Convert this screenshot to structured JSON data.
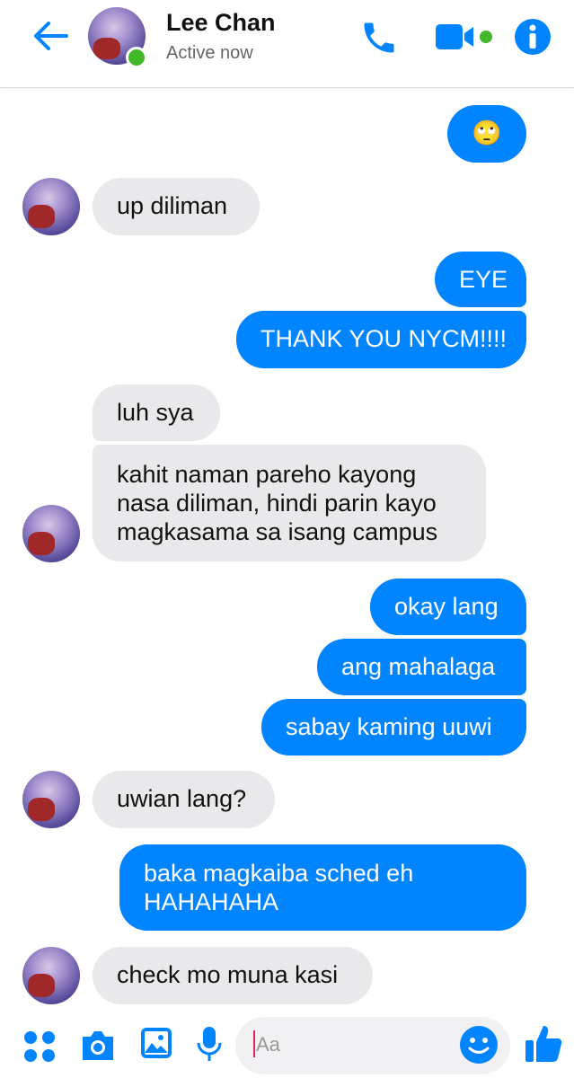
{
  "header": {
    "contact_name": "Lee Chan",
    "status": "Active now",
    "icons": [
      "back-arrow-icon",
      "phone-icon",
      "video-camera-icon",
      "info-icon"
    ]
  },
  "messages": [
    {
      "side": "out",
      "text": "🙄"
    },
    {
      "side": "in",
      "text": "up diliman"
    },
    {
      "side": "out",
      "text": "EYE"
    },
    {
      "side": "out",
      "text": "THANK YOU NYCM!!!!"
    },
    {
      "side": "in",
      "text": "luh sya"
    },
    {
      "side": "in",
      "lines": [
        "kahit naman pareho kayong",
        "nasa diliman, hindi parin kayo",
        "magkasama sa isang campus"
      ]
    },
    {
      "side": "out",
      "text": "okay lang"
    },
    {
      "side": "out",
      "text": "ang mahalaga"
    },
    {
      "side": "out",
      "text": "sabay kaming uuwi"
    },
    {
      "side": "in",
      "text": "uwian lang?"
    },
    {
      "side": "out",
      "lines": [
        "baka magkaiba sched eh",
        "HAHAHAHA"
      ]
    },
    {
      "side": "in",
      "text": "check mo muna kasi"
    }
  ],
  "composer": {
    "placeholder": "Aa",
    "icons": [
      "apps-icon",
      "camera-icon",
      "gallery-icon",
      "microphone-icon",
      "emoji-icon",
      "like-icon"
    ]
  },
  "colors": {
    "accent": "#0084ff",
    "incoming_bubble": "#e9e9eb",
    "online": "#42b72a"
  }
}
